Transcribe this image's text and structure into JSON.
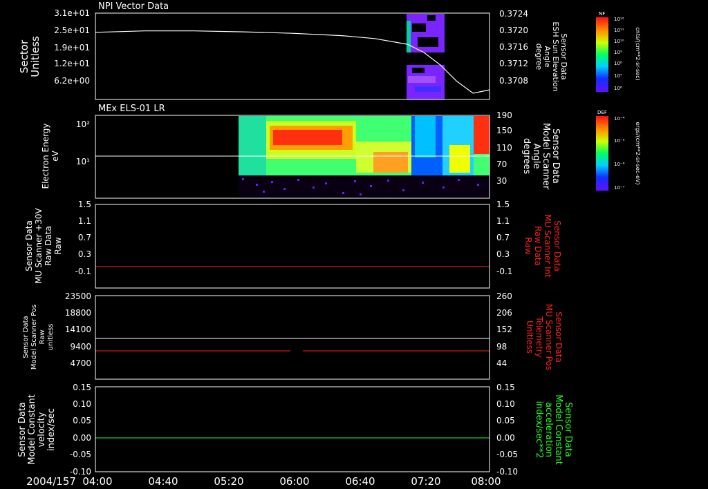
{
  "colors": {
    "background": "#000000",
    "axis": "#ffffff",
    "red_trace": "#ff2020",
    "green_trace": "#20ff20",
    "white_trace": "#ffffff"
  },
  "time_axis": {
    "date_label": "2004/157",
    "start": "04:00",
    "end": "08:00",
    "tick_labels": [
      "04:00",
      "04:40",
      "05:20",
      "06:00",
      "06:40",
      "07:20",
      "08:00"
    ]
  },
  "chart_data": [
    {
      "type": "heatmap",
      "title": "NPI Vector Data",
      "ylabel": "Sector",
      "yunits": "Unitless",
      "yticks": [
        "3.1e+01",
        "2.5e+01",
        "1.9e+01",
        "1.2e+01",
        "6.2e+00"
      ],
      "ylim": [
        0,
        32
      ],
      "right_axis": {
        "labels": [
          "Sensor Data",
          "ESH Sun Elevation",
          "Angle",
          "degree"
        ],
        "ticks": [
          "0.3724",
          "0.3720",
          "0.3716",
          "0.3712",
          "0.3708"
        ],
        "ylim": [
          0.3706,
          0.3724
        ]
      },
      "colorbar": {
        "label": "NF",
        "units": "cnts/(cm**2-sr-sec)",
        "ticks": [
          "10¹²",
          "10¹¹",
          "10¹⁰",
          "10⁹",
          "10⁸",
          "10⁷",
          "10⁶"
        ]
      },
      "data_window": [
        "07:12",
        "07:26"
      ],
      "series": [
        {
          "type": "line",
          "x": [
            "04:00",
            "04:30",
            "05:00",
            "05:30",
            "06:00",
            "06:30",
            "06:50",
            "07:10",
            "07:20",
            "07:30",
            "07:40",
            "07:50",
            "08:00"
          ],
          "y": [
            0.372,
            0.37203,
            0.37203,
            0.37201,
            0.37198,
            0.37193,
            0.37187,
            0.37175,
            0.37158,
            0.37132,
            0.37098,
            0.37073,
            0.3708
          ]
        }
      ]
    },
    {
      "type": "heatmap",
      "title": "MEx ELS-01 LR",
      "ylabel": "Electron Energy",
      "yunits": "eV",
      "yticks": [
        "10²",
        "10¹"
      ],
      "scale": "log",
      "right_axis": {
        "labels": [
          "Sensor Data",
          "Model Scanner",
          "Angle",
          "degrees"
        ],
        "ticks": [
          "190",
          "150",
          "110",
          "70",
          "30"
        ],
        "ylim": [
          0,
          190
        ]
      },
      "colorbar": {
        "label": "DEF",
        "units": "ergs/(cm**2-sr-sec-eV)",
        "ticks": [
          "10⁻⁴",
          "10⁻⁵",
          "10⁻⁶",
          "10⁻⁷"
        ]
      },
      "data_start": "05:25",
      "series": [
        {
          "type": "line",
          "name": "",
          "constant": 90
        }
      ]
    },
    {
      "type": "line",
      "ylabel": [
        "Sensor Data",
        "MU Scanner +30V",
        "Raw Data",
        "Raw"
      ],
      "yticks": [
        "1.5",
        "1.1",
        "0.7",
        "0.3",
        "-0.1"
      ],
      "ylim": [
        -0.3,
        1.5
      ],
      "right_axis": {
        "labels": [
          "Sensor Data",
          "MU Scanner Int",
          "Raw Data",
          "Raw"
        ],
        "ticks": [
          "1.5",
          "1.1",
          "0.7",
          "0.3",
          "-0.1"
        ],
        "ylim": [
          -0.3,
          1.5
        ]
      },
      "series": [
        {
          "color": "red",
          "constant": 0.0
        }
      ]
    },
    {
      "type": "line",
      "ylabel": [
        "Sensor Data",
        "Model Scanner Pos",
        "Raw",
        "unitless"
      ],
      "yticks": [
        "23500",
        "18800",
        "14100",
        "9400",
        "4700"
      ],
      "ylim": [
        0,
        23500
      ],
      "right_axis": {
        "labels": [
          "Sensor Data",
          "MU Scanner Pos",
          "Telemetry",
          "Unitless"
        ],
        "ticks": [
          "260",
          "206",
          "152",
          "98",
          "44"
        ],
        "ylim": [
          0,
          260
        ]
      },
      "series": [
        {
          "color": "white",
          "constant": 11750
        },
        {
          "color": "red",
          "constant": 90,
          "gap": [
            "06:00",
            "06:05"
          ]
        }
      ]
    },
    {
      "type": "line",
      "ylabel": [
        "Sensor Data",
        "Model Constant",
        "velocity",
        "index/sec"
      ],
      "yticks": [
        "0.15",
        "0.10",
        "0.05",
        "0.00",
        "-0.05",
        "-0.10"
      ],
      "ylim": [
        -0.1,
        0.15
      ],
      "right_axis": {
        "labels": [
          "Sensor Data",
          "Model Constant",
          "acceleration",
          "index/sec**2"
        ],
        "ticks": [
          "0.15",
          "0.10",
          "0.05",
          "0.00",
          "-0.05",
          "-0.10"
        ],
        "ylim": [
          -0.1,
          0.15
        ]
      },
      "series": [
        {
          "color": "green",
          "constant": 0.0
        }
      ]
    }
  ]
}
